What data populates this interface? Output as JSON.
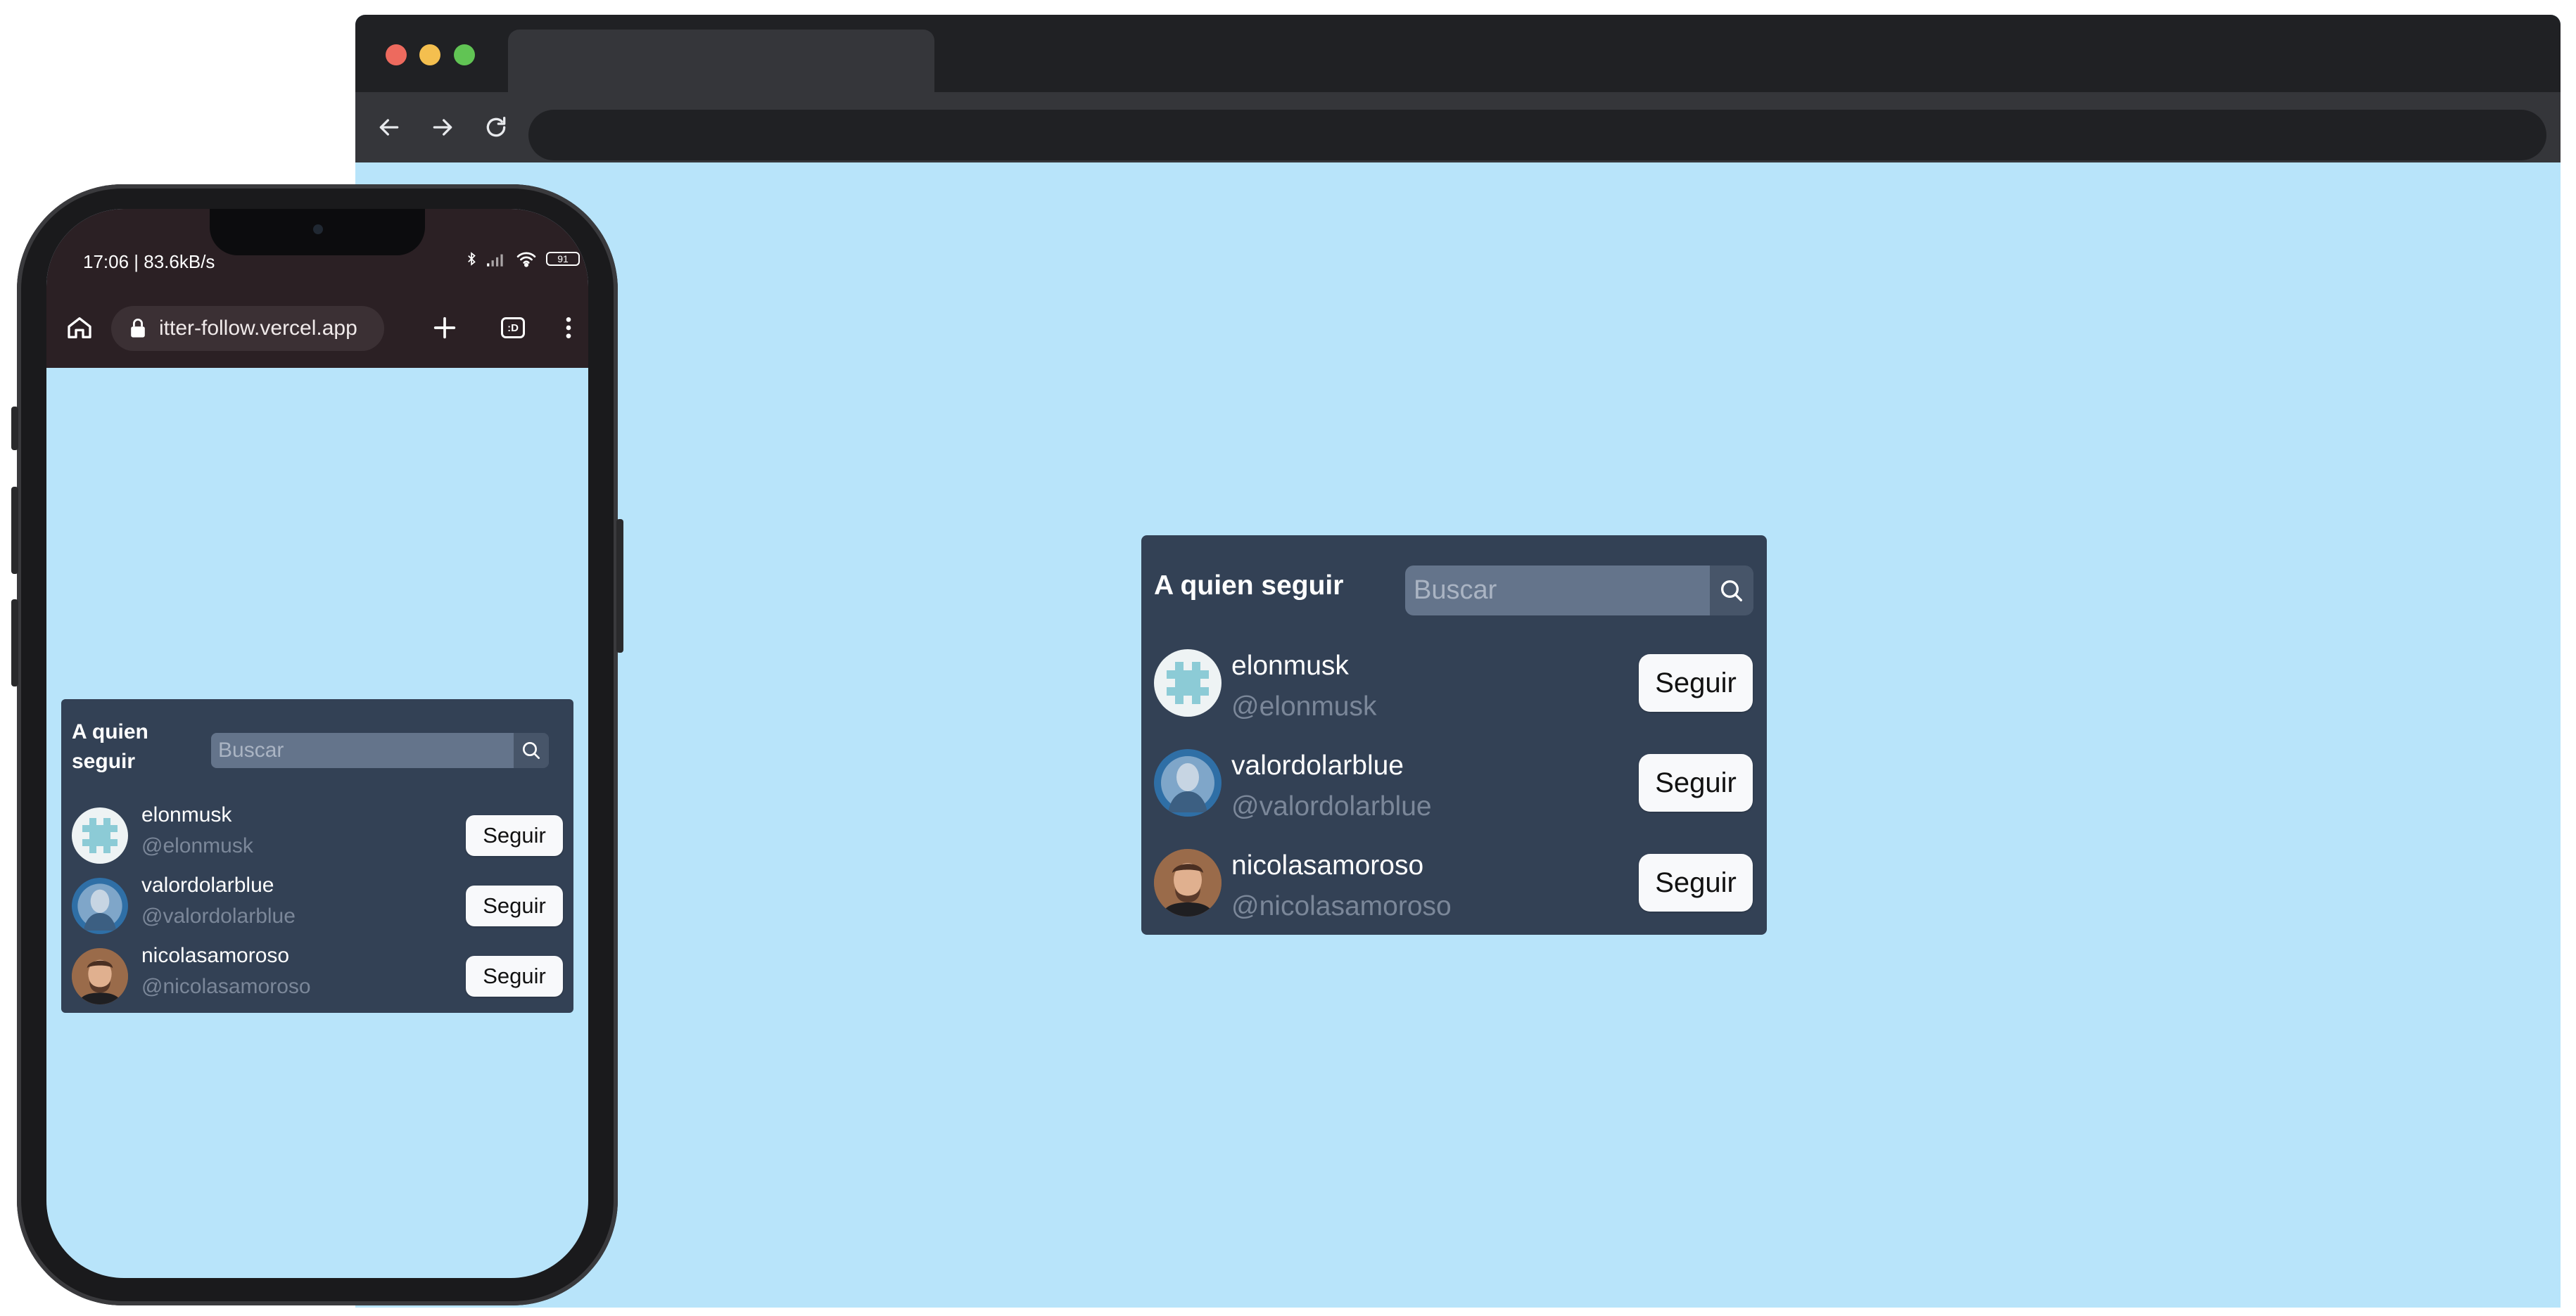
{
  "browser": {
    "colors": {
      "viewport_bg": "#b8e4fa",
      "chrome": "#202124",
      "toolbar": "#35363a"
    },
    "icons": [
      "back-arrow-icon",
      "forward-arrow-icon",
      "reload-icon"
    ]
  },
  "phone": {
    "status_time": "17:06 | 83.6kB/s",
    "battery": "91",
    "url": "itter-follow.vercel.app",
    "tabs_count": ":D",
    "icons": [
      "home-icon",
      "lock-icon",
      "plus-icon",
      "tabs-icon",
      "more-vert-icon",
      "bluetooth-icon",
      "signal-icon",
      "wifi-icon"
    ]
  },
  "widget": {
    "title": "A quien seguir",
    "search_placeholder": "Buscar",
    "colors": {
      "panel": "#334155",
      "search": "#64748b",
      "handle": "#7b8799",
      "button_bg": "#f8f9fb"
    },
    "users": [
      {
        "name": "elonmusk",
        "handle": "@elonmusk",
        "button": "Seguir"
      },
      {
        "name": "valordolarblue",
        "handle": "@valordolarblue",
        "button": "Seguir"
      },
      {
        "name": "nicolasamoroso",
        "handle": "@nicolasamoroso",
        "button": "Seguir"
      }
    ]
  }
}
